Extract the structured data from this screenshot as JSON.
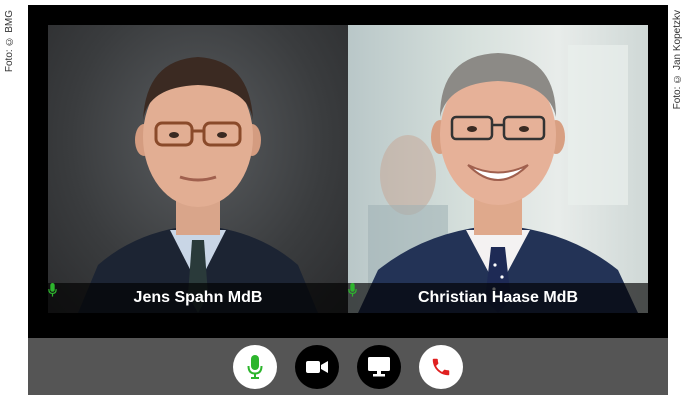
{
  "credits": {
    "left": "Foto: © BMG",
    "right": "Foto: © Jan Kopetzkv"
  },
  "participants": [
    {
      "name": "Jens Spahn MdB",
      "mic_icon": "mic-icon",
      "mic_color": "#2db52d"
    },
    {
      "name": "Christian Haase MdB",
      "mic_icon": "mic-icon",
      "mic_color": "#2db52d"
    }
  ],
  "controls": [
    {
      "icon": "mic-icon",
      "color": "#2db52d",
      "background": "#ffffff"
    },
    {
      "icon": "video-camera-icon",
      "color": "#ffffff",
      "background": "#000000"
    },
    {
      "icon": "screen-share-icon",
      "color": "#ffffff",
      "background": "#000000"
    },
    {
      "icon": "hang-up-phone-icon",
      "color": "#e02020",
      "background": "#ffffff"
    }
  ]
}
